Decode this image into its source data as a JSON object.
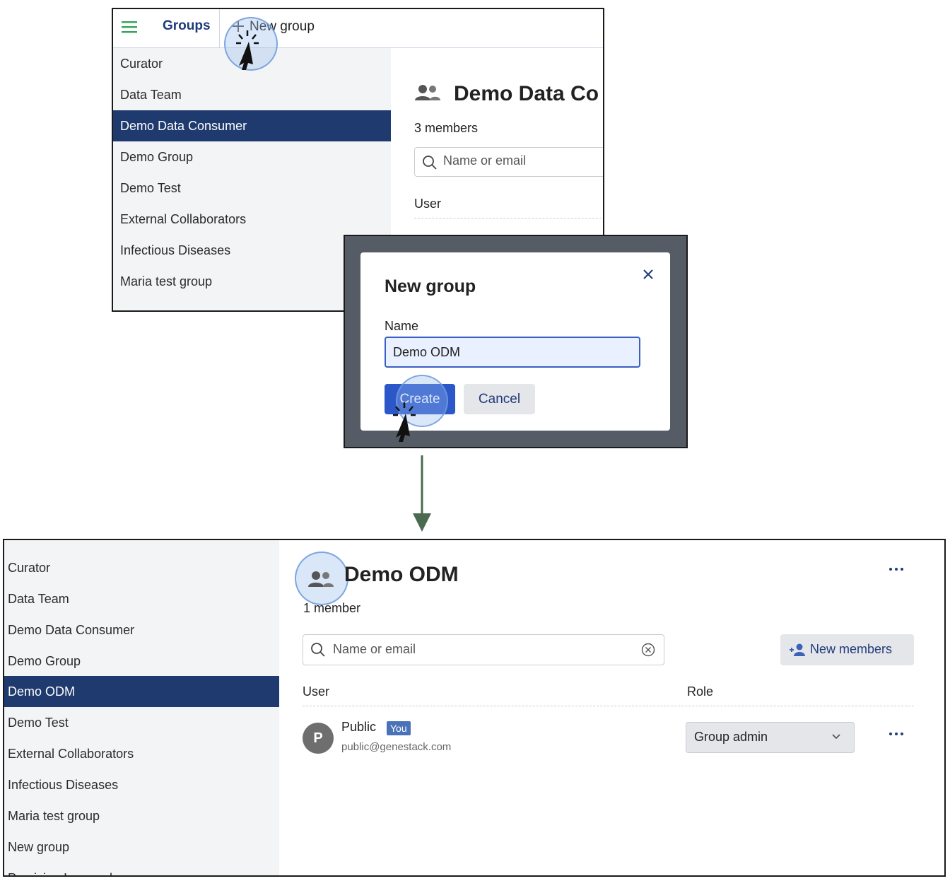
{
  "top_panel": {
    "header": {
      "title": "Groups",
      "new_group_label": "New group"
    },
    "sidebar_items": [
      {
        "label": "Curator",
        "active": false
      },
      {
        "label": "Data Team",
        "active": false
      },
      {
        "label": "Demo Data Consumer",
        "active": true
      },
      {
        "label": "Demo Group",
        "active": false
      },
      {
        "label": "Demo Test",
        "active": false
      },
      {
        "label": "External Collaborators",
        "active": false
      },
      {
        "label": "Infectious Diseases",
        "active": false
      },
      {
        "label": "Maria test group",
        "active": false
      }
    ],
    "main": {
      "group_title": "Demo Data Co",
      "members_count": "3 members",
      "search_placeholder": "Name or email",
      "user_column": "User"
    }
  },
  "modal": {
    "title": "New group",
    "name_label": "Name",
    "name_value": "Demo ODM",
    "create_label": "Create",
    "cancel_label": "Cancel"
  },
  "bottom_panel": {
    "sidebar_items": [
      {
        "label": "Curator",
        "active": false
      },
      {
        "label": "Data Team",
        "active": false
      },
      {
        "label": "Demo Data Consumer",
        "active": false
      },
      {
        "label": "Demo Group",
        "active": false
      },
      {
        "label": "Demo ODM",
        "active": true
      },
      {
        "label": "Demo Test",
        "active": false
      },
      {
        "label": "External Collaborators",
        "active": false
      },
      {
        "label": "Infectious Diseases",
        "active": false
      },
      {
        "label": "Maria test group",
        "active": false
      },
      {
        "label": "New group",
        "active": false
      },
      {
        "label": "Precision Immunology",
        "active": false
      }
    ],
    "main": {
      "group_title": "Demo ODM",
      "members_count": "1 member",
      "search_placeholder": "Name or email",
      "new_members_label": "New members",
      "user_column": "User",
      "role_column": "Role",
      "members": [
        {
          "avatar_letter": "P",
          "name": "Public",
          "badge": "You",
          "email": "public@genestack.com",
          "role": "Group admin"
        }
      ]
    }
  },
  "colors": {
    "accent_navy": "#1f3a6e",
    "primary_button": "#2b57c9",
    "arrow_green": "#4a6b4f",
    "menu_icon_green": "#3aa55d"
  },
  "icons": {
    "menu": "menu-icon",
    "plus": "plus-icon",
    "group": "group-icon",
    "search": "search-icon",
    "close": "close-icon",
    "clear": "clear-circle-icon",
    "add_person": "add-person-icon",
    "more": "more-dots-icon",
    "chevron": "chevron-down-icon",
    "cursor": "cursor-icon"
  }
}
